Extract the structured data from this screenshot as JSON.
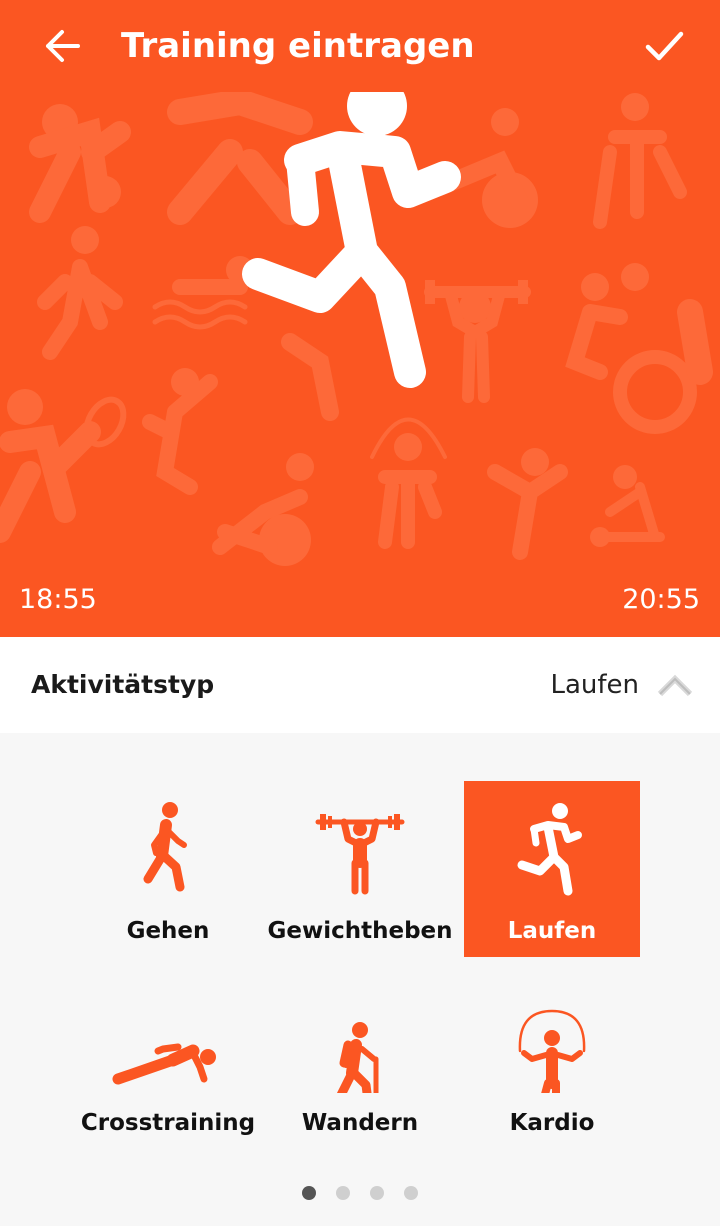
{
  "header": {
    "title": "Training eintragen",
    "back_icon": "arrow-left-icon",
    "confirm_icon": "checkmark-icon"
  },
  "hero": {
    "start_time": "18:55",
    "end_time": "20:55",
    "activity_icon": "running-icon",
    "background_color": "#fb5622"
  },
  "activity_type": {
    "label": "Aktivitätstyp",
    "value": "Laufen",
    "expand_icon": "chevron-up-icon"
  },
  "activities": [
    {
      "label": "Gehen",
      "icon": "walking-icon",
      "selected": false
    },
    {
      "label": "Gewichtheben",
      "icon": "weightlifting-icon",
      "selected": false
    },
    {
      "label": "Laufen",
      "icon": "running-icon",
      "selected": true
    },
    {
      "label": "Crosstraining",
      "icon": "pushup-icon",
      "selected": false
    },
    {
      "label": "Wandern",
      "icon": "hiking-icon",
      "selected": false
    },
    {
      "label": "Kardio",
      "icon": "jump-rope-icon",
      "selected": false
    }
  ],
  "pagination": {
    "pages": 4,
    "current": 1
  },
  "colors": {
    "accent": "#fb5622",
    "text": "#111111",
    "dot_inactive": "#cfcfcf",
    "dot_active": "#555555"
  }
}
